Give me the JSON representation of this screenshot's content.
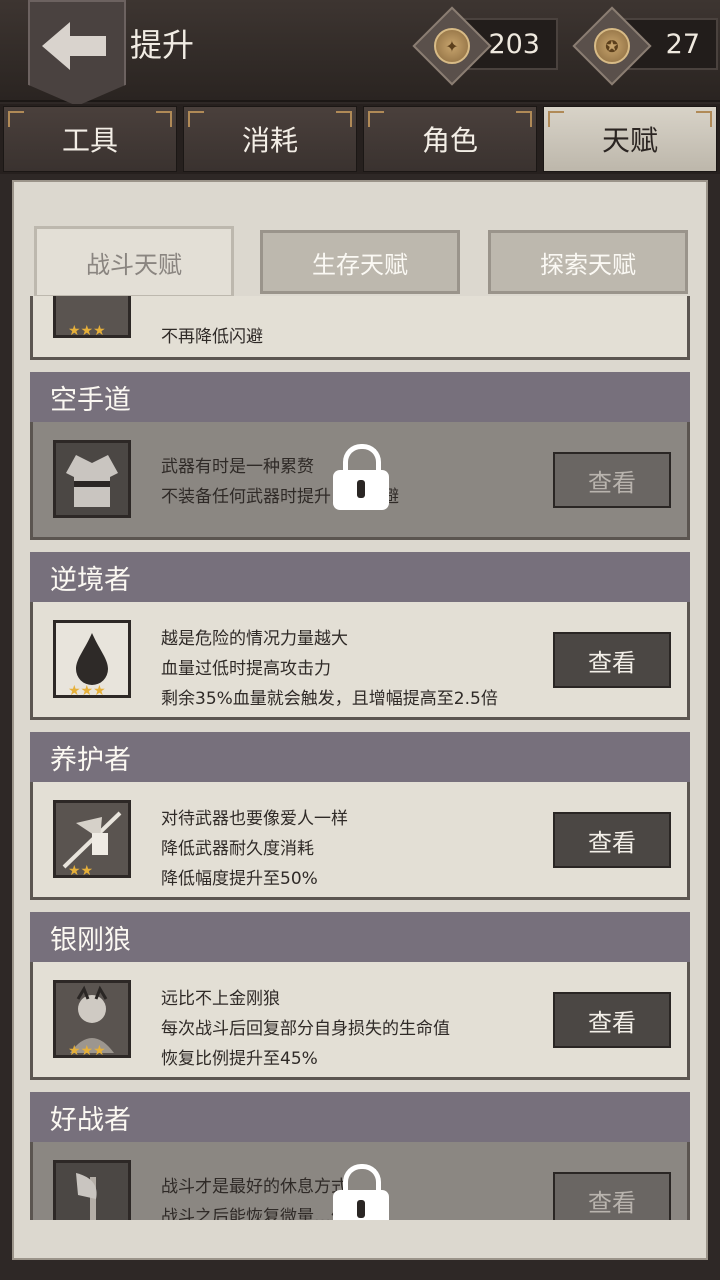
{
  "header": {
    "title": "提升",
    "currency_1": "203",
    "currency_2": "27"
  },
  "main_tabs": [
    {
      "label": "工具"
    },
    {
      "label": "消耗"
    },
    {
      "label": "角色"
    },
    {
      "label": "天赋",
      "active": true
    }
  ],
  "sub_tabs": [
    {
      "label": "战斗天赋",
      "active": true
    },
    {
      "label": "生存天赋"
    },
    {
      "label": "探索天赋"
    }
  ],
  "talents": [
    {
      "name": "",
      "lines": [
        "不再降低闪避"
      ],
      "stars": "★★★",
      "partial": true
    },
    {
      "name": "空手道",
      "lines": [
        "武器有时是一种累赘",
        "不装备任何武器时提升…和闪避"
      ],
      "locked": true,
      "button": "查看",
      "icon": "karate-gi-icon"
    },
    {
      "name": "逆境者",
      "lines": [
        "越是危险的情况力量越大",
        "血量过低时提高攻击力",
        "剩余35%血量就会触发，且增幅提高至2.5倍"
      ],
      "stars": "★★★",
      "button": "查看",
      "icon": "blood-drop-icon"
    },
    {
      "name": "养护者",
      "lines": [
        "对待武器也要像爱人一样",
        "降低武器耐久度消耗",
        "降低幅度提升至50%"
      ],
      "stars": "★★",
      "button": "查看",
      "icon": "spear-hat-icon"
    },
    {
      "name": "银刚狼",
      "lines": [
        "远比不上金刚狼",
        "每次战斗后回复部分自身损失的生命值",
        "恢复比例提升至45%"
      ],
      "stars": "★★★",
      "button": "查看",
      "icon": "wolverine-icon"
    },
    {
      "name": "好战者",
      "lines": [
        "战斗才是最好的休息方式",
        "战斗之后能恢复微量…值"
      ],
      "locked": true,
      "button": "查看",
      "icon": "axe-icon"
    }
  ],
  "colors": {
    "header_bg": "#77707c",
    "star": "#e6b03a",
    "panel": "#dcd8cf"
  }
}
